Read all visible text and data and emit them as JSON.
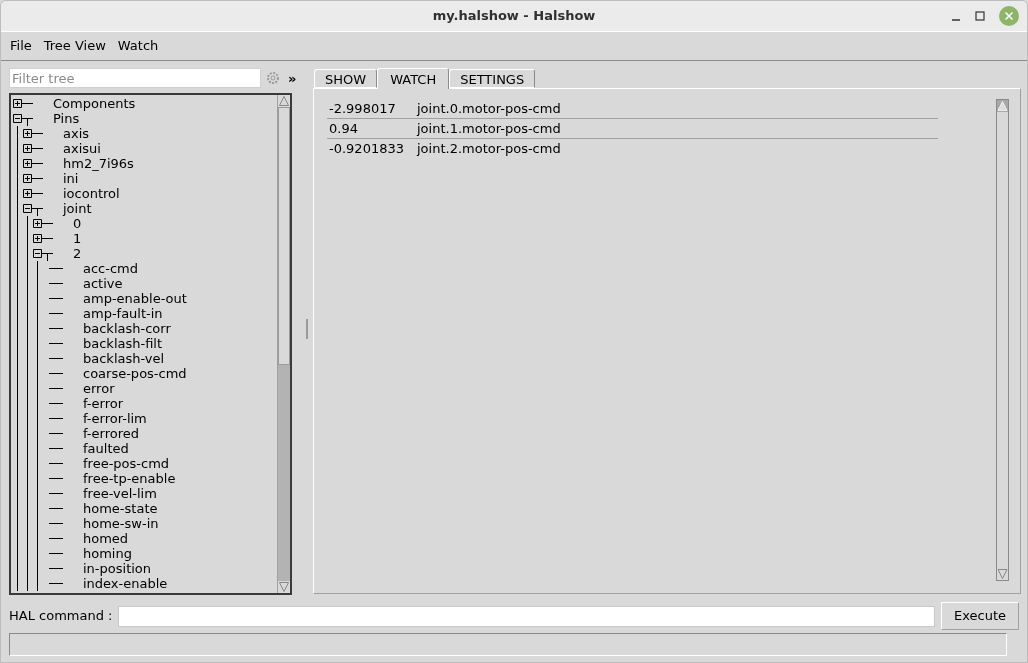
{
  "window": {
    "title": "my.halshow - Halshow"
  },
  "menu": [
    "File",
    "Tree View",
    "Watch"
  ],
  "filter": {
    "placeholder": "Filter tree",
    "expand_label": "»"
  },
  "tree": [
    {
      "label": "Components",
      "expanded": false
    },
    {
      "label": "Pins",
      "expanded": true,
      "children": [
        {
          "label": "axis",
          "expanded": false
        },
        {
          "label": "axisui",
          "expanded": false
        },
        {
          "label": "hm2_7i96s",
          "expanded": false
        },
        {
          "label": "ini",
          "expanded": false
        },
        {
          "label": "iocontrol",
          "expanded": false
        },
        {
          "label": "joint",
          "expanded": true,
          "children": [
            {
              "label": "0",
              "expanded": false
            },
            {
              "label": "1",
              "expanded": false
            },
            {
              "label": "2",
              "expanded": true,
              "children": [
                {
                  "label": "acc-cmd"
                },
                {
                  "label": "active"
                },
                {
                  "label": "amp-enable-out"
                },
                {
                  "label": "amp-fault-in"
                },
                {
                  "label": "backlash-corr"
                },
                {
                  "label": "backlash-filt"
                },
                {
                  "label": "backlash-vel"
                },
                {
                  "label": "coarse-pos-cmd"
                },
                {
                  "label": "error"
                },
                {
                  "label": "f-error"
                },
                {
                  "label": "f-error-lim"
                },
                {
                  "label": "f-errored"
                },
                {
                  "label": "faulted"
                },
                {
                  "label": "free-pos-cmd"
                },
                {
                  "label": "free-tp-enable"
                },
                {
                  "label": "free-vel-lim"
                },
                {
                  "label": "home-state"
                },
                {
                  "label": "home-sw-in"
                },
                {
                  "label": "homed"
                },
                {
                  "label": "homing"
                },
                {
                  "label": "in-position"
                },
                {
                  "label": "index-enable"
                }
              ]
            }
          ]
        }
      ]
    }
  ],
  "tabs": [
    {
      "label": "SHOW",
      "selected": false
    },
    {
      "label": "WATCH",
      "selected": true
    },
    {
      "label": "SETTINGS",
      "selected": false
    }
  ],
  "watch": [
    {
      "value": "-2.998017",
      "pin": "joint.0.motor-pos-cmd"
    },
    {
      "value": "0.94",
      "pin": "joint.1.motor-pos-cmd"
    },
    {
      "value": "-0.9201833",
      "pin": "joint.2.motor-pos-cmd"
    }
  ],
  "command": {
    "label": "HAL command :",
    "button": "Execute"
  }
}
